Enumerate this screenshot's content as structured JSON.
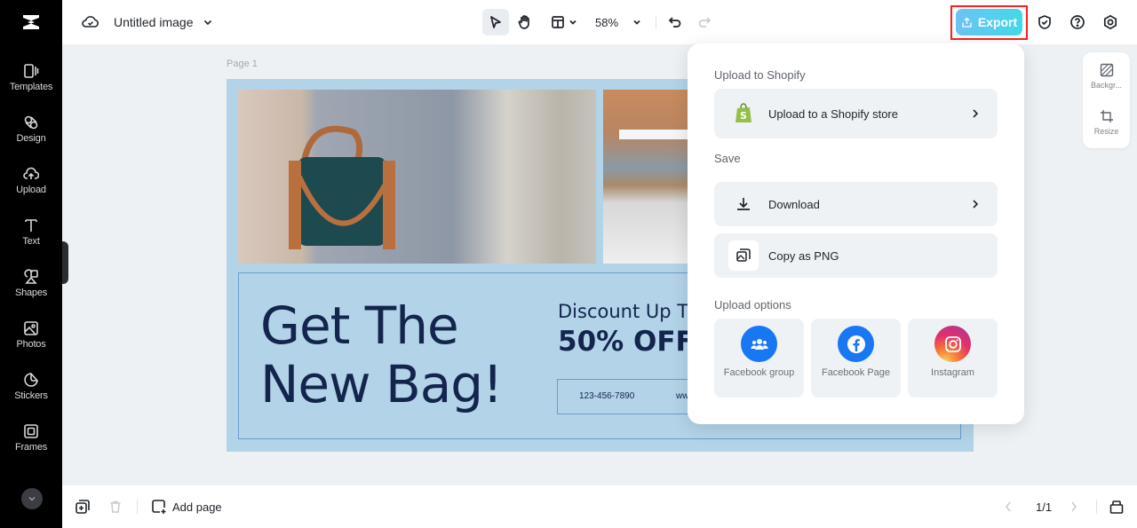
{
  "app": {
    "logo": "capcut-logo-icon"
  },
  "sidebar": {
    "items": [
      {
        "label": "Templates",
        "icon": "templates-icon"
      },
      {
        "label": "Design",
        "icon": "design-icon"
      },
      {
        "label": "Upload",
        "icon": "upload-cloud-icon"
      },
      {
        "label": "Text",
        "icon": "text-icon"
      },
      {
        "label": "Shapes",
        "icon": "shapes-icon"
      },
      {
        "label": "Photos",
        "icon": "photos-icon"
      },
      {
        "label": "Stickers",
        "icon": "stickers-icon"
      },
      {
        "label": "Frames",
        "icon": "frames-icon"
      }
    ],
    "more_icon": "chevron-down-icon"
  },
  "header": {
    "doc_title": "Untitled image",
    "zoom": "58%",
    "export_label": "Export",
    "tools": [
      "select-pointer-icon",
      "hand-pan-icon",
      "layout-icon",
      "undo-icon",
      "redo-icon"
    ],
    "right_icons": [
      "shield-check-icon",
      "help-icon",
      "settings-icon"
    ]
  },
  "canvas": {
    "page_label": "Page 1",
    "design": {
      "headline_line1": "Get The",
      "headline_line2": "New Bag!",
      "discount_line1": "Discount Up T",
      "discount_line2": "50% OFF",
      "phone": "123-456-7890",
      "website": "ww"
    }
  },
  "right_panel": {
    "items": [
      {
        "label": "Backgr...",
        "icon": "background-icon"
      },
      {
        "label": "Resize",
        "icon": "resize-icon"
      }
    ]
  },
  "export_menu": {
    "shopify_section": "Upload to Shopify",
    "shopify_item": "Upload to a Shopify store",
    "save_section": "Save",
    "download_item": "Download",
    "copy_item": "Copy as PNG",
    "upload_section": "Upload options",
    "upload_options": [
      {
        "label": "Facebook group",
        "color": "#1877f2"
      },
      {
        "label": "Facebook Page",
        "color": "#1877f2"
      },
      {
        "label": "Instagram",
        "color": "#e1306c"
      }
    ]
  },
  "footer": {
    "add_page": "Add page",
    "page_indicator": "1/1"
  },
  "colors": {
    "accent_export": "#41d9e9",
    "annotation_red": "#ff1f1f",
    "design_bg": "#b3d3e8",
    "design_text": "#13244d"
  }
}
